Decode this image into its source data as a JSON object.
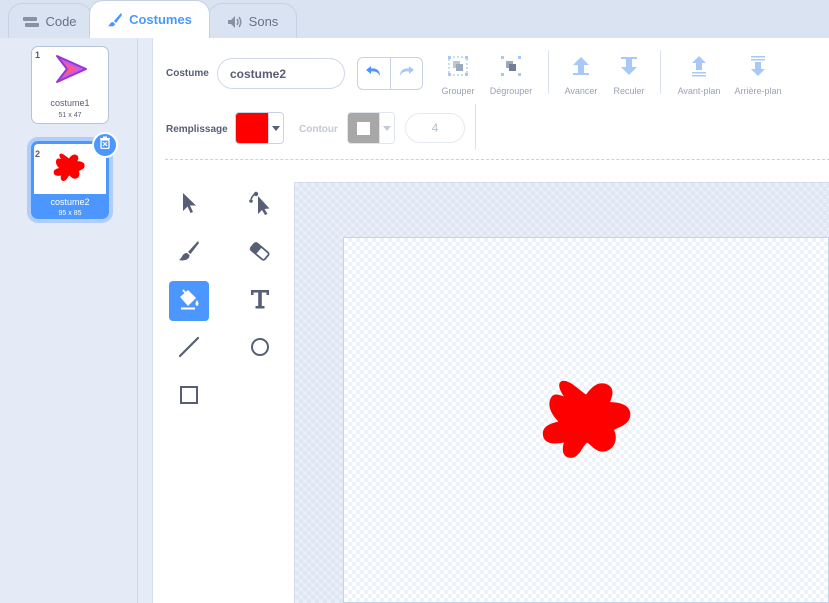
{
  "tabs": [
    {
      "label": "Code",
      "icon": "code-blocks-icon"
    },
    {
      "label": "Costumes",
      "icon": "brush-icon"
    },
    {
      "label": "Sons",
      "icon": "speaker-icon"
    }
  ],
  "costumes": [
    {
      "number": "1",
      "name": "costume1",
      "size": "51 x 47",
      "icon": "arrow-sprite-thumbnail"
    },
    {
      "number": "2",
      "name": "costume2",
      "size": "95 x 85",
      "icon": "red-splat-thumbnail"
    }
  ],
  "editor": {
    "costume_label": "Costume",
    "costume_name": "costume2",
    "actions": {
      "group": "Grouper",
      "ungroup": "Dégrouper",
      "forward": "Avancer",
      "backward": "Reculer",
      "front": "Avant-plan",
      "back": "Arrière-plan"
    },
    "fill_label": "Remplissage",
    "fill_color": "#ff0000",
    "outline_label": "Contour",
    "outline_color": "#ffffff",
    "stroke_width": "4"
  },
  "tools": [
    "select",
    "reshape",
    "brush",
    "eraser",
    "fill",
    "text",
    "line",
    "circle",
    "rectangle"
  ],
  "active_tool": "fill",
  "colors": {
    "accent": "#4c97ff",
    "splat": "#ff0000"
  }
}
